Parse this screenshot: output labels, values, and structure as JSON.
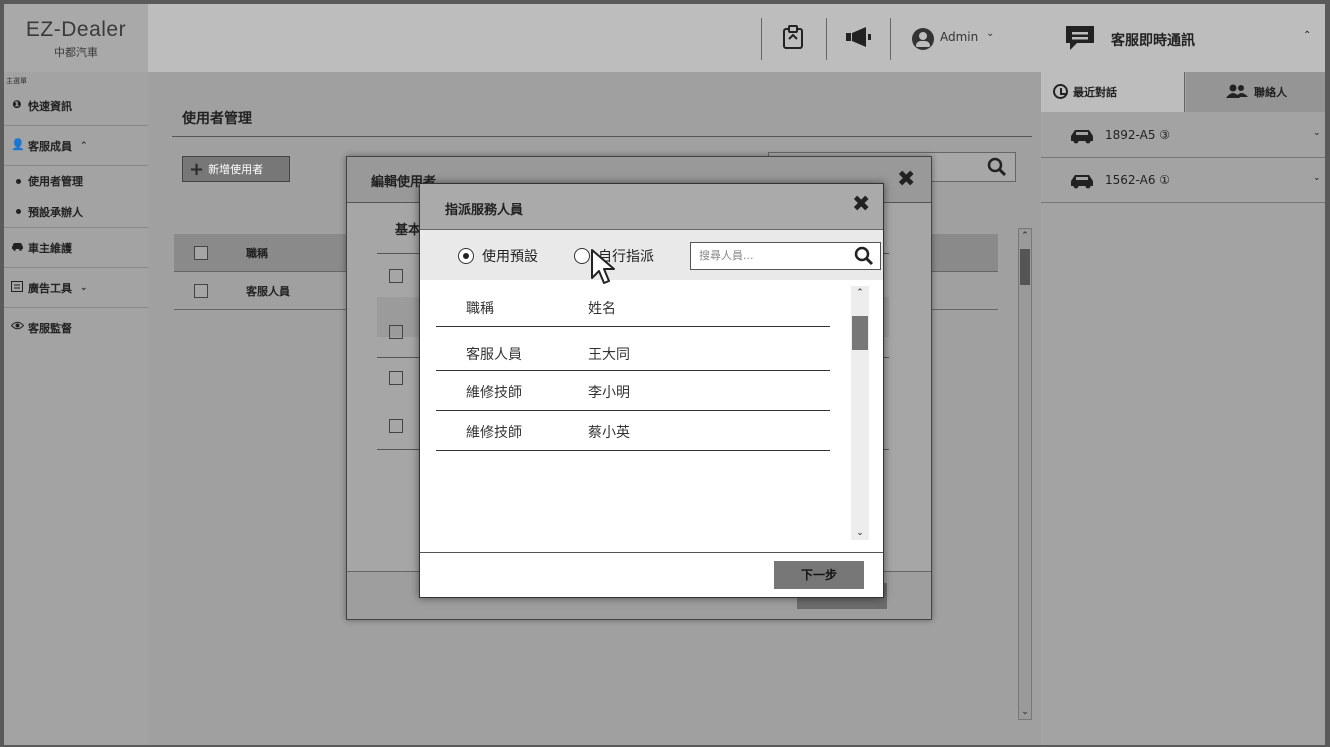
{
  "app": {
    "brand": "EZ-Dealer",
    "brand_sub": "中都汽車"
  },
  "topbar": {
    "admin_label": "Admin",
    "admin_caret": "⌄",
    "icons": [
      "clipboard-icon",
      "megaphone-icon",
      "user-avatar-icon"
    ]
  },
  "sidebar": {
    "caption": "主選單",
    "items": [
      {
        "label": "快速資訊",
        "icon": "info-icon"
      },
      {
        "label": "客服成員",
        "icon": "user-icon",
        "caret": "⌃"
      },
      {
        "label": "車主維護",
        "icon": "car-icon"
      },
      {
        "label": "廣告工具",
        "icon": "ad-icon",
        "caret": "⌄"
      },
      {
        "label": "客服監督",
        "icon": "eye-icon"
      }
    ],
    "subitems": [
      {
        "label": "使用者管理"
      },
      {
        "label": "預設承辦人"
      }
    ]
  },
  "main": {
    "page_title": "使用者管理",
    "add_user_label": "新增使用者",
    "table": {
      "header_col": "職稱",
      "rows": [
        {
          "col": "客服人員"
        }
      ]
    }
  },
  "edit_dialog": {
    "title": "編輯使用者",
    "tab_partial": "基本"
  },
  "assign_dialog": {
    "title": "指派服務人員",
    "radio_default": "使用預設",
    "radio_manual": "自行指派",
    "selected_radio": "default",
    "search_placeholder": "搜尋人員...",
    "columns": {
      "role": "職稱",
      "name": "姓名"
    },
    "rows": [
      {
        "role": "客服人員",
        "name": "王大同"
      },
      {
        "role": "維修技師",
        "name": "李小明"
      },
      {
        "role": "維修技師",
        "name": "蔡小英"
      }
    ],
    "next_label": "下一步"
  },
  "chat": {
    "title": "客服即時通訊",
    "tabs": {
      "recent": "最近對話",
      "contacts": "聯絡人"
    },
    "conversations": [
      {
        "plate": "1892-A5",
        "count": "③"
      },
      {
        "plate": "1562-A6",
        "count": "①"
      }
    ]
  }
}
